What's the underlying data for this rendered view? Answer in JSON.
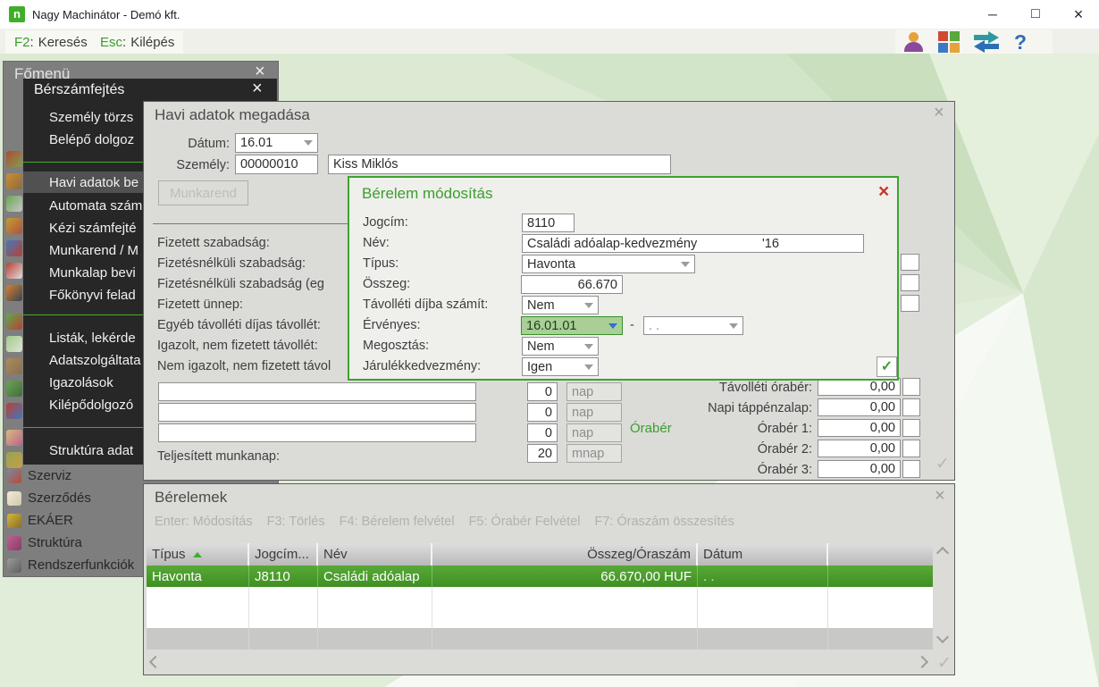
{
  "colors": {
    "accent_green": "#3fa32a",
    "modal_border": "#3da32e",
    "selected_row_green": "#459a28",
    "highlighted_field_green": "#a9cf97",
    "close_red": "#c13a2c",
    "desktop_green": "#dcead3"
  },
  "glyphs": {
    "close": "×",
    "check": "✓",
    "minimize": "─",
    "maximize": "□",
    "question": "?",
    "dash": "-"
  },
  "window": {
    "logo": "n",
    "title": "Nagy Machinátor - Demó kft."
  },
  "hotkey_bar": {
    "items": [
      {
        "key": "F2",
        "sep": ":",
        "label": "Keresés"
      },
      {
        "key": "Esc",
        "sep": ":",
        "label": "Kilépés"
      }
    ]
  },
  "fomenu": {
    "title": "Főmenü",
    "items": [
      "Szerviz",
      "Szerződés",
      "EKÁER",
      "Struktúra",
      "Rendszerfunkciók"
    ]
  },
  "bersz": {
    "title": "Bérszámfejtés",
    "items": [
      "Személy törzs",
      "Belépő dolgoz",
      "Havi adatok be",
      "Automata szám",
      "Kézi számfejté",
      "Munkarend / M",
      "Munkalap bevi",
      "Főkönyvi felad",
      "Listák, lekérde",
      "Adatszolgáltata",
      "Igazolások",
      "Kilépődolgozó",
      "Struktúra adat"
    ],
    "selected": "Havi adatok be"
  },
  "havi": {
    "title": "Havi adatok megadása",
    "datum_label": "Dátum:",
    "datum_value": "16.01",
    "szemely_label": "Személy:",
    "szemely_code": "00000010",
    "szemely_name": "Kiss Miklós",
    "munkarend_button": "Munkarend",
    "absence_labels": [
      "Fizetett szabadság:",
      "Fizetésnélküli szabadság:",
      "Fizetésnélküli szabadság (eg",
      "Fizetett ünnep:",
      "Egyéb távolléti díjas távollét:",
      "Igazolt, nem fizetett távollét:",
      "Nem igazolt, nem fizetett távol"
    ],
    "day_rows": [
      {
        "value": "0",
        "unit": "nap"
      },
      {
        "value": "0",
        "unit": "nap"
      },
      {
        "value": "0",
        "unit": "nap"
      }
    ],
    "teljesitett_label": "Teljesített munkanap:",
    "teljesitett_value": "20",
    "teljesitett_unit": "mnap",
    "oraber_label": "Órabér",
    "right_rows": [
      {
        "label": "Távolléti órabér:",
        "value": "0,00"
      },
      {
        "label": "Napi táppénzalap:",
        "value": "0,00"
      },
      {
        "label": "Órabér 1:",
        "value": "0,00"
      },
      {
        "label": "Órabér 2:",
        "value": "0,00"
      },
      {
        "label": "Órabér 3:",
        "value": "0,00"
      }
    ]
  },
  "modal": {
    "title": "Bérelem módosítás",
    "rows": [
      {
        "label": "Jogcím:",
        "value": "8110"
      },
      {
        "label": "Név:",
        "value": "Családi adóalap-kedvezmény",
        "suffix": "'16"
      },
      {
        "label": "Típus:",
        "value": "Havonta"
      },
      {
        "label": "Összeg:",
        "value": "66.670"
      },
      {
        "label": "Távolléti díjba számít:",
        "value": "Nem"
      },
      {
        "label": "Érvényes:",
        "from": "16.01.01",
        "to": ". ."
      },
      {
        "label": "Megosztás:",
        "value": "Nem"
      },
      {
        "label": "Járulékkedvezmény:",
        "value": "Igen"
      }
    ]
  },
  "berelemek": {
    "title": "Bérelemek",
    "hotkeys": [
      "Enter: Módosítás",
      "F3: Törlés",
      "F4: Bérelem felvétel",
      "F5: Órabér Felvétel",
      "F7: Óraszám összesítés"
    ],
    "columns": [
      "Típus",
      "Jogcím...",
      "Név",
      "Összeg/Óraszám",
      "Dátum",
      ""
    ],
    "row": {
      "tipus": "Havonta",
      "jogcim": "J8110",
      "nev": "Családi adóalap",
      "osszeg": "66.670,00 HUF",
      "datum": ". ."
    }
  }
}
